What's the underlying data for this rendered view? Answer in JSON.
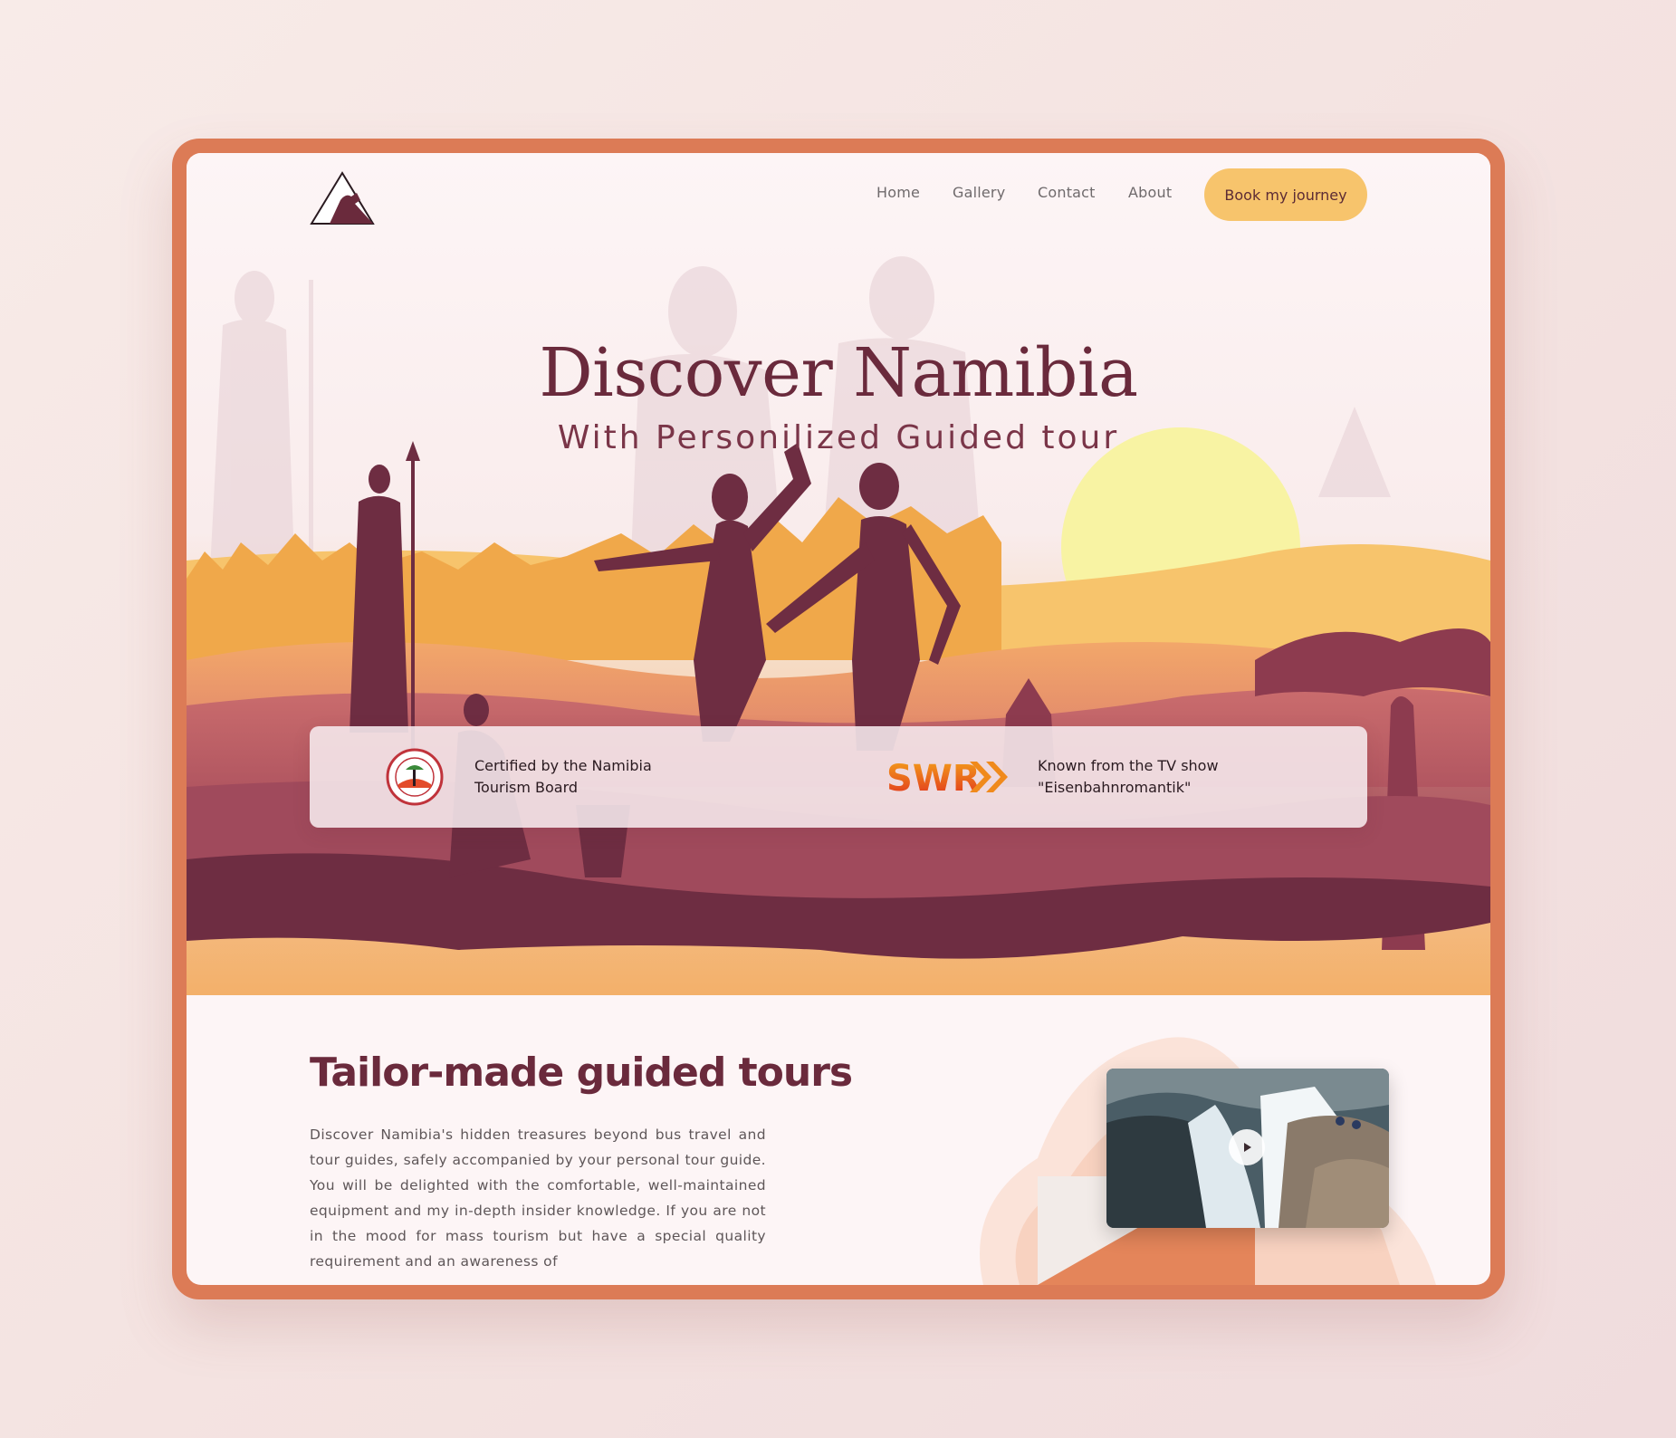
{
  "nav": {
    "links": [
      "Home",
      "Gallery",
      "Contact",
      "About"
    ],
    "cta_label": "Book my journey"
  },
  "hero": {
    "title": "Discover Namibia",
    "subtitle": "With Personilized Guided tour"
  },
  "badges": {
    "certified": {
      "line1": "Certified by the Namibia",
      "line2": "Tourism Board",
      "icon": "tourism-board-seal"
    },
    "tv": {
      "line1": "Known from the TV show",
      "line2": "\"Eisenbahnromantik\"",
      "logo_text": "SWR"
    }
  },
  "section": {
    "title": "Tailor-made guided tours",
    "body": "Discover Namibia's hidden treasures beyond bus travel and tour guides, safely accompanied by your personal tour guide. You will be delighted with the comfortable, well-maintained equipment and my in-depth insider knowledge. If you are not in the mood for mass tourism but have a special quality requirement and an awareness of"
  },
  "colors": {
    "frame": "#dc7b56",
    "accent": "#f7c46c",
    "brand_dark": "#6a2a3c",
    "sun": "#f8f3a3"
  },
  "icons": [
    "logo-mountain-icon",
    "play-icon"
  ]
}
